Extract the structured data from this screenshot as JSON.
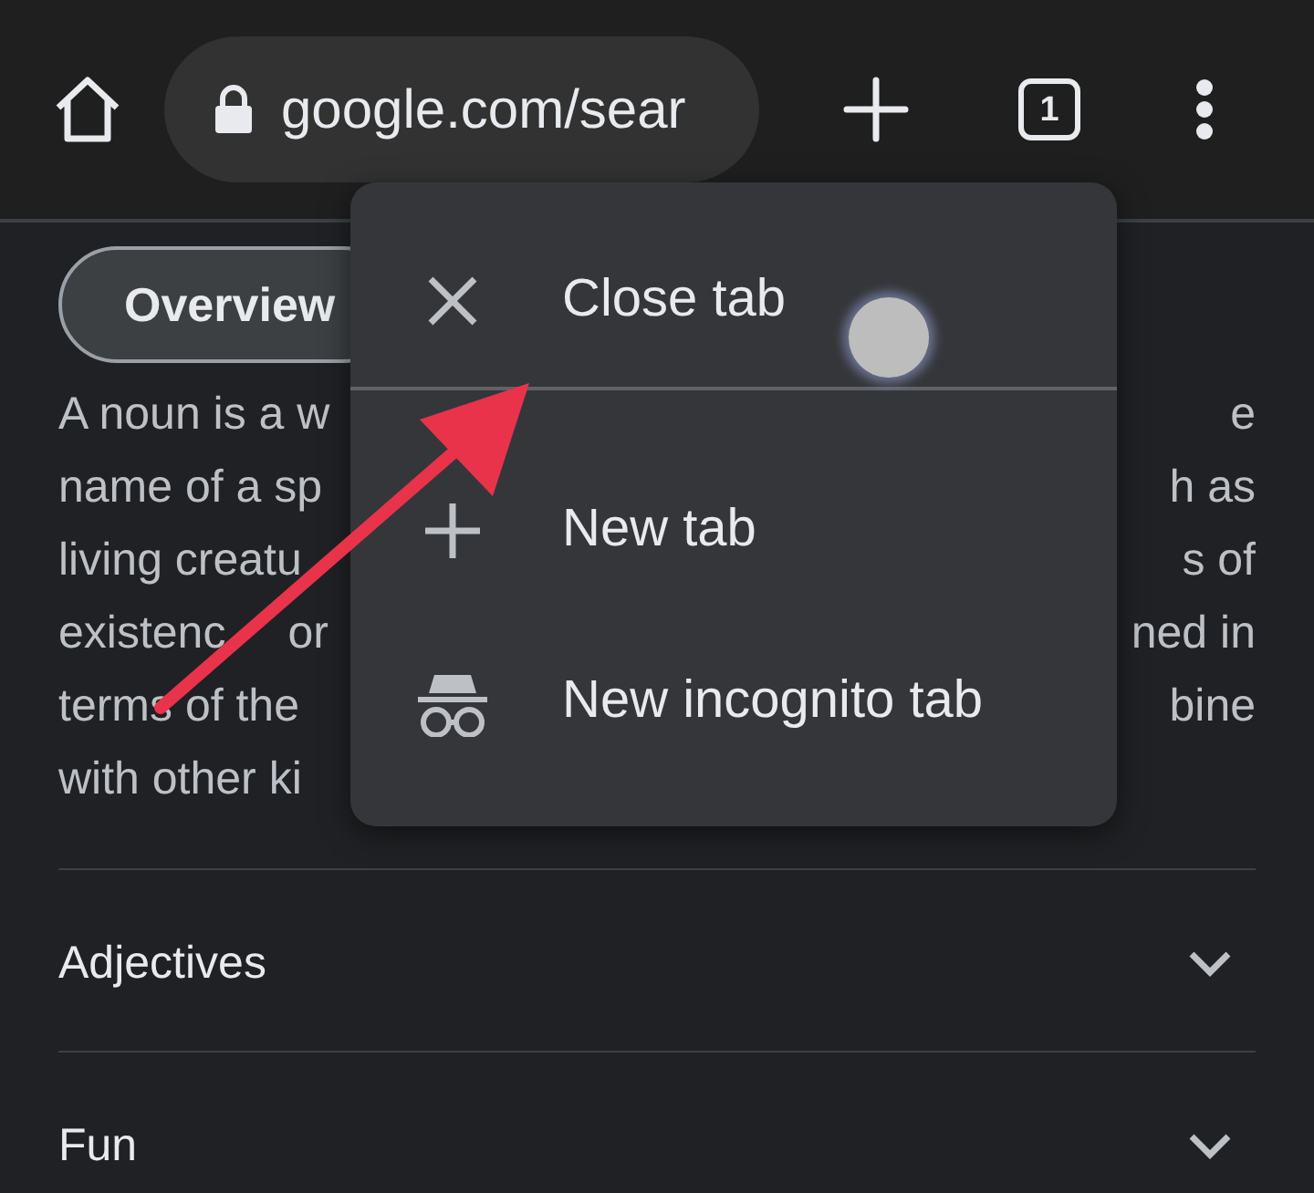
{
  "toolbar": {
    "url": "google.com/sear",
    "tab_count": "1"
  },
  "chips": [
    {
      "label": "Overview",
      "selected": true
    }
  ],
  "paragraph_lines": [
    {
      "left": "A noun is a w",
      "right": "e"
    },
    {
      "left": "name of a sp",
      "right": "h as"
    },
    {
      "left": "living creatu",
      "right": "s of"
    },
    {
      "left": "existenc",
      "left_after_arrow": "or",
      "right": "ned in"
    },
    {
      "left": "terms of the",
      "right": "bine"
    },
    {
      "left": "with other ki"
    }
  ],
  "sections": [
    {
      "label": "Adjectives",
      "expanded": false
    },
    {
      "label": "Fun",
      "expanded": false
    }
  ],
  "menu": {
    "items": [
      {
        "kind": "close",
        "label": "Close tab",
        "divider_after": true
      },
      {
        "kind": "new",
        "label": "New tab",
        "divider_after": false
      },
      {
        "kind": "incognito",
        "label": "New incognito tab",
        "divider_after": false
      }
    ]
  }
}
